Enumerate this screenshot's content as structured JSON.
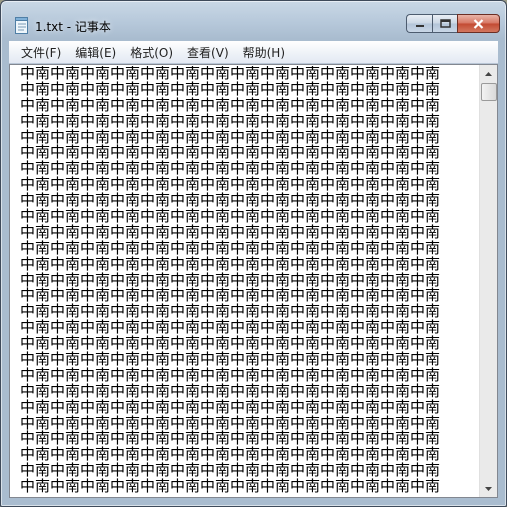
{
  "window": {
    "title": "1.txt - 记事本",
    "app_icon": "notepad-icon"
  },
  "caption_buttons": {
    "minimize_icon": "minimize-icon",
    "maximize_icon": "maximize-icon",
    "close_icon": "close-icon"
  },
  "menu": {
    "items": [
      {
        "label": "文件(F)"
      },
      {
        "label": "编辑(E)"
      },
      {
        "label": "格式(O)"
      },
      {
        "label": "查看(V)"
      },
      {
        "label": "帮助(H)"
      }
    ]
  },
  "document": {
    "lines": [
      "中南中南中南中南中南中南中南中南中南中南中南中南中南中南",
      "中南中南中南中南中南中南中南中南中南中南中南中南中南中南",
      "中南中南中南中南中南中南中南中南中南中南中南中南中南中南",
      "中南中南中南中南中南中南中南中南中南中南中南中南中南中南",
      "中南中南中南中南中南中南中南中南中南中南中南中南中南中南",
      "中南中南中南中南中南中南中南中南中南中南中南中南中南中南",
      "中南中南中南中南中南中南中南中南中南中南中南中南中南中南",
      "中南中南中南中南中南中南中南中南中南中南中南中南中南中南",
      "中南中南中南中南中南中南中南中南中南中南中南中南中南中南",
      "中南中南中南中南中南中南中南中南中南中南中南中南中南中南",
      "中南中南中南中南中南中南中南中南中南中南中南中南中南中南",
      "中南中南中南中南中南中南中南中南中南中南中南中南中南中南",
      "中南中南中南中南中南中南中南中南中南中南中南中南中南中南",
      "中南中南中南中南中南中南中南中南中南中南中南中南中南中南",
      "中南中南中南中南中南中南中南中南中南中南中南中南中南中南",
      "中南中南中南中南中南中南中南中南中南中南中南中南中南中南",
      "中南中南中南中南中南中南中南中南中南中南中南中南中南中南",
      "中南中南中南中南中南中南中南中南中南中南中南中南中南中南",
      "中南中南中南中南中南中南中南中南中南中南中南中南中南中南",
      "中南中南中南中南中南中南中南中南中南中南中南中南中南中南",
      "中南中南中南中南中南中南中南中南中南中南中南中南中南中南",
      "中南中南中南中南中南中南中南中南中南中南中南中南中南中南",
      "中南中南中南中南中南中南中南中南中南中南中南中南中南中南",
      "中南中南中南中南中南中南中南中南中南中南中南中南中南中南",
      "中南中南中南中南中南中南中南中南中南中南中南中南中南中南",
      "中南中南中南中南中南中南中南中南中南中南中南中南中南中南",
      "中南中南中南中南中南中南中南中南中南中南中南中南中南中南"
    ]
  },
  "scrollbar": {
    "up_icon": "scroll-up-arrow-icon",
    "down_icon": "scroll-down-arrow-icon"
  }
}
